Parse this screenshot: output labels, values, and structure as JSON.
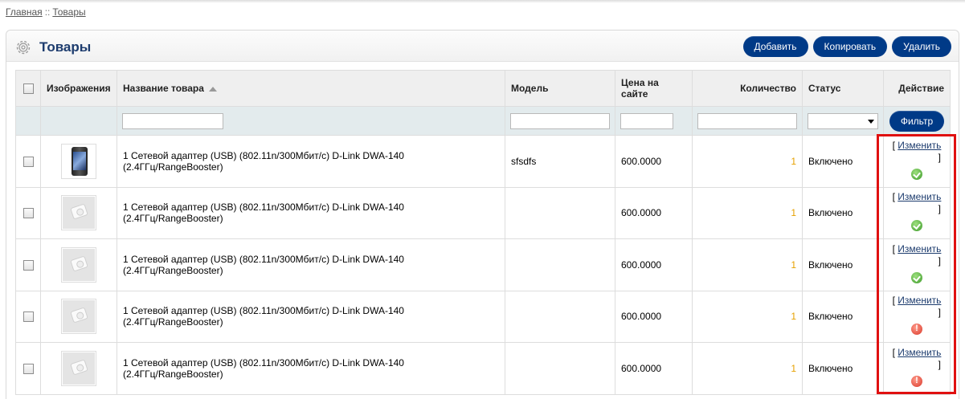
{
  "breadcrumb": {
    "home": "Главная",
    "separator": "::",
    "current": "Товары"
  },
  "panel": {
    "title": "Товары",
    "icon": "gear-icon"
  },
  "toolbar": {
    "add_label": "Добавить",
    "copy_label": "Копировать",
    "delete_label": "Удалить"
  },
  "table": {
    "headers": {
      "images": "Изображения",
      "name": "Название товара",
      "model": "Модель",
      "price": "Цена на сайте",
      "quantity": "Количество",
      "status": "Статус",
      "action": "Действие"
    },
    "filter_button": "Фильтр",
    "rows": [
      {
        "name": "1 Сетевой адаптер (USB) (802.11n/300Мбит/с) D-Link DWA-140 (2.4ГГц/RangeBooster)",
        "model": "sfsdfs",
        "price": "600.0000",
        "quantity": "1",
        "status": "Включено",
        "action_label": "Изменить",
        "action_open": "[",
        "action_close": "]",
        "image": "phone",
        "state": "ok"
      },
      {
        "name": "1 Сетевой адаптер (USB) (802.11n/300Мбит/с) D-Link DWA-140 (2.4ГГц/RangeBooster)",
        "model": "",
        "price": "600.0000",
        "quantity": "1",
        "status": "Включено",
        "action_label": "Изменить",
        "action_open": "[",
        "action_close": "]",
        "image": "placeholder",
        "state": "ok"
      },
      {
        "name": "1 Сетевой адаптер (USB) (802.11n/300Мбит/с) D-Link DWA-140 (2.4ГГц/RangeBooster)",
        "model": "",
        "price": "600.0000",
        "quantity": "1",
        "status": "Включено",
        "action_label": "Изменить",
        "action_open": "[",
        "action_close": "]",
        "image": "placeholder",
        "state": "ok"
      },
      {
        "name": "1 Сетевой адаптер (USB) (802.11n/300Мбит/с) D-Link DWA-140 (2.4ГГц/RangeBooster)",
        "model": "",
        "price": "600.0000",
        "quantity": "1",
        "status": "Включено",
        "action_label": "Изменить",
        "action_open": "[",
        "action_close": "]",
        "image": "placeholder",
        "state": "warn"
      },
      {
        "name": "1 Сетевой адаптер (USB) (802.11n/300Мбит/с) D-Link DWA-140 (2.4ГГц/RangeBooster)",
        "model": "",
        "price": "600.0000",
        "quantity": "1",
        "status": "Включено",
        "action_label": "Изменить",
        "action_open": "[",
        "action_close": "]",
        "image": "placeholder",
        "state": "warn"
      }
    ]
  },
  "colors": {
    "accent": "#003a87",
    "title": "#1d3c6e",
    "highlight_border": "#e01010",
    "quantity": "#e6a100",
    "ok": "#3d9a2a",
    "warn": "#d9392b"
  }
}
